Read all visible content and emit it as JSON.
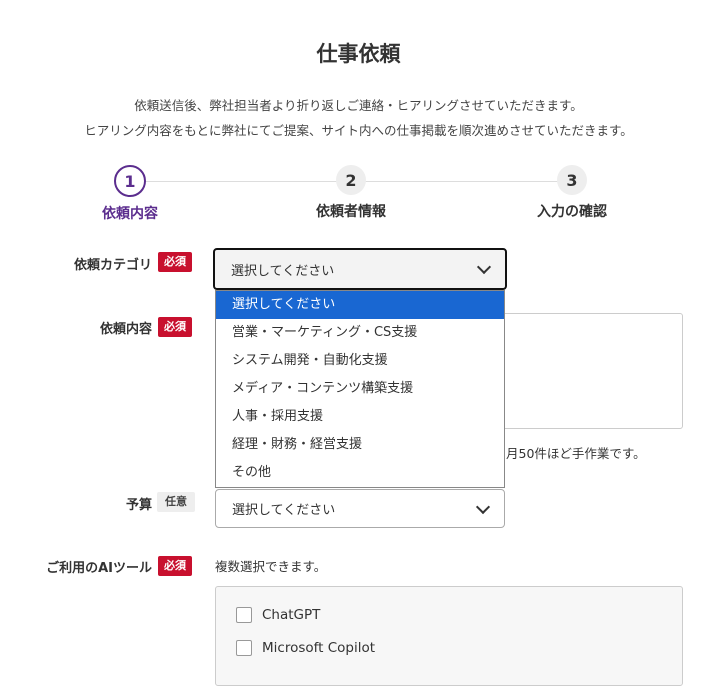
{
  "page": {
    "title": "仕事依頼",
    "desc1": "依頼送信後、弊社担当者より折り返しご連絡・ヒアリングさせていただきます。",
    "desc2": "ヒアリング内容をもとに弊社にてご提案、サイト内への仕事掲載を順次進めさせていただきます。"
  },
  "steps": [
    {
      "num": "1",
      "label": "依頼内容",
      "active": true
    },
    {
      "num": "2",
      "label": "依頼者情報",
      "active": false
    },
    {
      "num": "3",
      "label": "入力の確認",
      "active": false
    }
  ],
  "form": {
    "category": {
      "label": "依頼カテゴリ",
      "badge": "必須",
      "value": "選択してください"
    },
    "content": {
      "label": "依頼内容",
      "badge": "必須",
      "note_partial": "月50件ほど手作業です。"
    },
    "budget": {
      "label": "予算",
      "badge": "任意",
      "value": "選択してください"
    },
    "ai_tools": {
      "label": "ご利用のAIツール",
      "badge": "必須",
      "help": "複数選択できます。",
      "options": [
        "ChatGPT",
        "Microsoft Copilot"
      ]
    }
  },
  "dropdown": {
    "options": [
      "選択してください",
      "営業・マーケティング・CS支援",
      "システム開発・自動化支援",
      "メディア・コンテンツ構築支援",
      "人事・採用支援",
      "経理・財務・経営支援",
      "その他"
    ],
    "selected_index": 0
  },
  "colors": {
    "accent": "#5b2d8e",
    "required": "#c8102e",
    "highlight": "#1967d2"
  }
}
